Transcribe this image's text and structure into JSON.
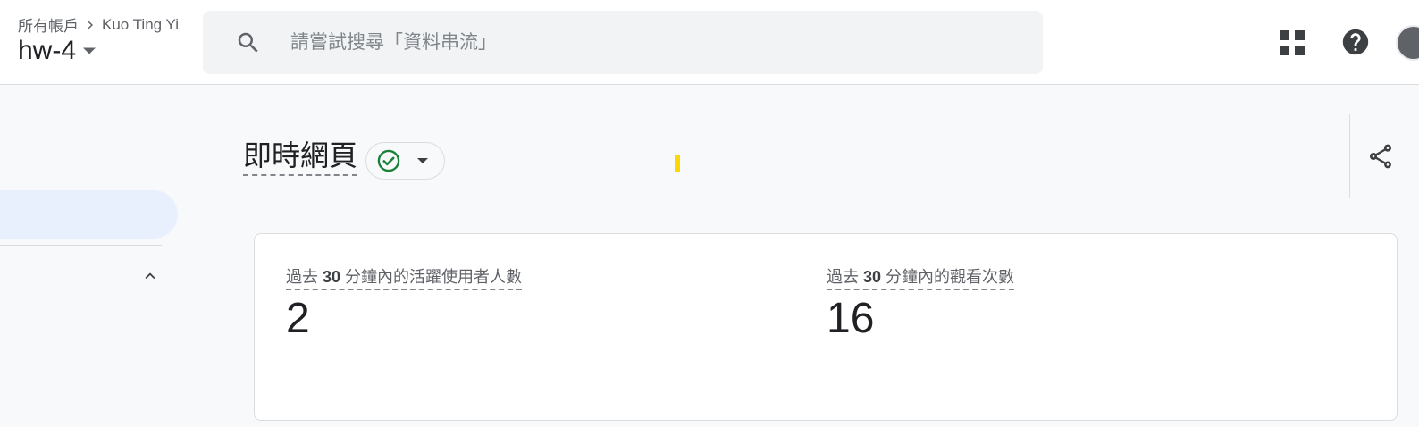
{
  "header": {
    "breadcrumb_root": "所有帳戶",
    "breadcrumb_account": "Kuo Ting Yi",
    "property_name": "hw-4"
  },
  "search": {
    "placeholder": "請嘗試搜尋「資料串流」"
  },
  "page": {
    "title": "即時網頁"
  },
  "metrics": [
    {
      "label_prefix": "過去 ",
      "label_number": "30",
      "label_suffix": " 分鐘內的活躍使用者人數",
      "value": "2"
    },
    {
      "label_prefix": "過去 ",
      "label_number": "30",
      "label_suffix": " 分鐘內的觀看次數",
      "value": "16"
    }
  ],
  "colors": {
    "accent_bg": "#e8f0fe",
    "status_green": "#188038",
    "highlight_yellow": "#fcd800"
  },
  "icons": {
    "search": "search-icon",
    "apps": "apps-grid-icon",
    "help": "help-icon",
    "share": "share-icon",
    "status": "check-circle-icon"
  }
}
